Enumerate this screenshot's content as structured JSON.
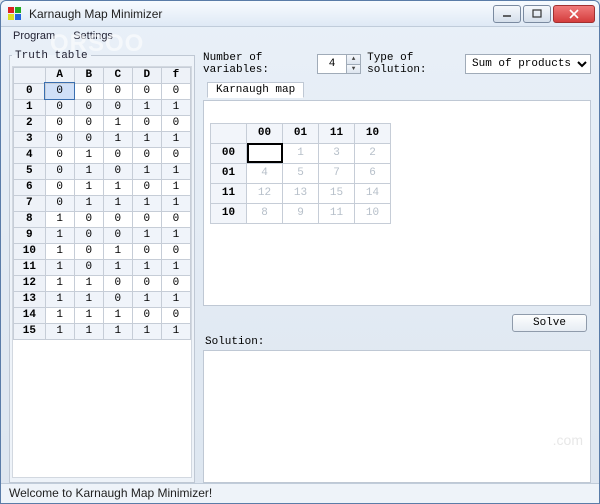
{
  "window": {
    "title": "Karnaugh Map Minimizer"
  },
  "menu": {
    "program": "Program",
    "settings": "Settings"
  },
  "truth_table": {
    "legend": "Truth table",
    "headers": [
      "",
      "A",
      "B",
      "C",
      "D",
      "f"
    ],
    "rows": [
      {
        "i": "0",
        "v": [
          "0",
          "0",
          "0",
          "0",
          "0"
        ]
      },
      {
        "i": "1",
        "v": [
          "0",
          "0",
          "0",
          "1",
          "1"
        ]
      },
      {
        "i": "2",
        "v": [
          "0",
          "0",
          "1",
          "0",
          "0"
        ]
      },
      {
        "i": "3",
        "v": [
          "0",
          "0",
          "1",
          "1",
          "1"
        ]
      },
      {
        "i": "4",
        "v": [
          "0",
          "1",
          "0",
          "0",
          "0"
        ]
      },
      {
        "i": "5",
        "v": [
          "0",
          "1",
          "0",
          "1",
          "1"
        ]
      },
      {
        "i": "6",
        "v": [
          "0",
          "1",
          "1",
          "0",
          "1"
        ]
      },
      {
        "i": "7",
        "v": [
          "0",
          "1",
          "1",
          "1",
          "1"
        ]
      },
      {
        "i": "8",
        "v": [
          "1",
          "0",
          "0",
          "0",
          "0"
        ]
      },
      {
        "i": "9",
        "v": [
          "1",
          "0",
          "0",
          "1",
          "1"
        ]
      },
      {
        "i": "10",
        "v": [
          "1",
          "0",
          "1",
          "0",
          "0"
        ]
      },
      {
        "i": "11",
        "v": [
          "1",
          "0",
          "1",
          "1",
          "1"
        ]
      },
      {
        "i": "12",
        "v": [
          "1",
          "1",
          "0",
          "0",
          "0"
        ]
      },
      {
        "i": "13",
        "v": [
          "1",
          "1",
          "0",
          "1",
          "1"
        ]
      },
      {
        "i": "14",
        "v": [
          "1",
          "1",
          "1",
          "0",
          "0"
        ]
      },
      {
        "i": "15",
        "v": [
          "1",
          "1",
          "1",
          "1",
          "1"
        ]
      }
    ]
  },
  "controls": {
    "numvars_label": "Number of variables:",
    "numvars_value": "4",
    "soltype_label": "Type of solution:",
    "soltype_value": "Sum of products"
  },
  "kmap": {
    "tab_label": "Karnaugh map",
    "col_headers": [
      "",
      "00",
      "01",
      "11",
      "10"
    ],
    "rows": [
      {
        "h": "00",
        "c": [
          "",
          "1",
          "3",
          "2"
        ]
      },
      {
        "h": "01",
        "c": [
          "4",
          "5",
          "7",
          "6"
        ]
      },
      {
        "h": "11",
        "c": [
          "12",
          "13",
          "15",
          "14"
        ]
      },
      {
        "h": "10",
        "c": [
          "8",
          "9",
          "11",
          "10"
        ]
      }
    ]
  },
  "buttons": {
    "solve": "Solve"
  },
  "solution": {
    "label": "Solution:",
    "text": ""
  },
  "status": {
    "text": "Welcome to Karnaugh Map Minimizer!"
  }
}
